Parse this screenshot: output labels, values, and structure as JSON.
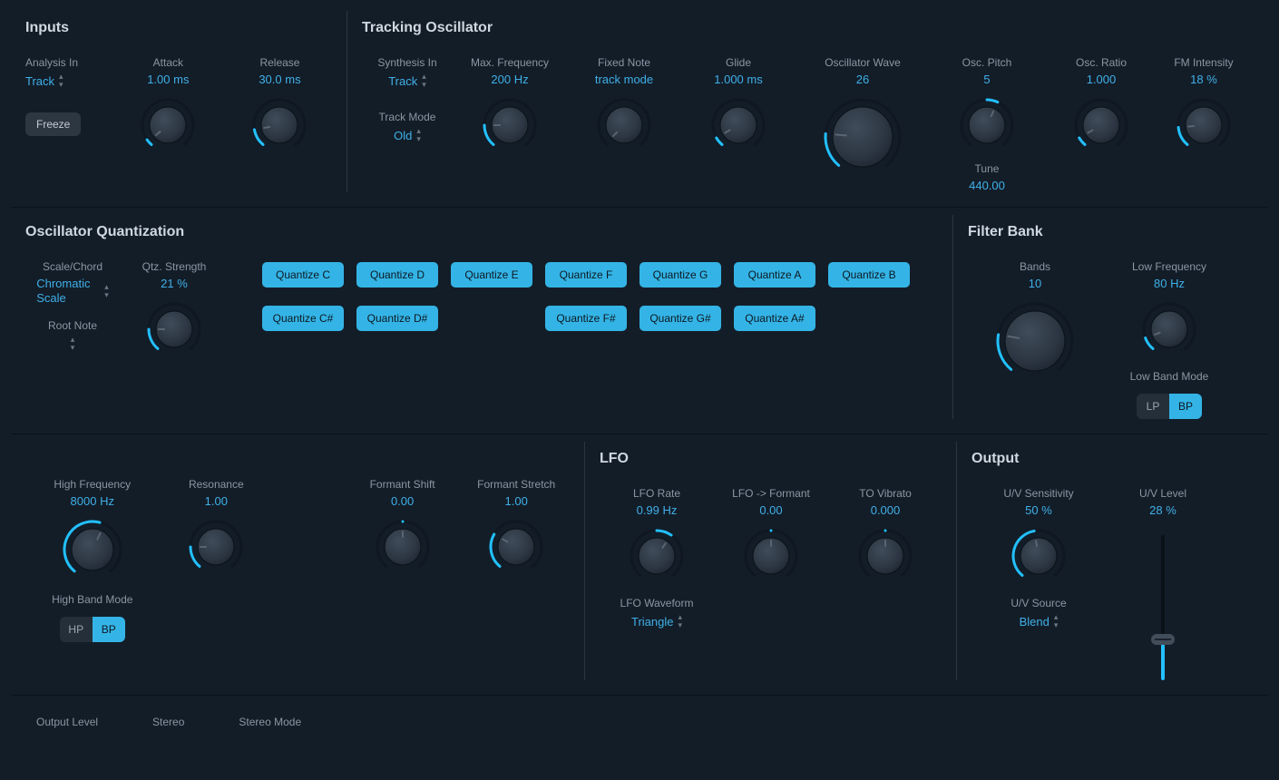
{
  "inputs": {
    "title": "Inputs",
    "analysisIn": {
      "label": "Analysis In",
      "value": "Track"
    },
    "attack": {
      "label": "Attack",
      "value": "1.00 ms"
    },
    "release": {
      "label": "Release",
      "value": "30.0 ms"
    },
    "freeze": "Freeze"
  },
  "tracking": {
    "title": "Tracking Oscillator",
    "synthesisIn": {
      "label": "Synthesis In",
      "value": "Track"
    },
    "trackMode": {
      "label": "Track Mode",
      "value": "Old"
    },
    "maxFreq": {
      "label": "Max. Frequency",
      "value": "200 Hz"
    },
    "fixedNote": {
      "label": "Fixed Note",
      "value": "track mode"
    },
    "glide": {
      "label": "Glide",
      "value": "1.000 ms"
    },
    "oscWave": {
      "label": "Oscillator Wave",
      "value": "26"
    },
    "oscPitch": {
      "label": "Osc. Pitch",
      "value": "5"
    },
    "tune": {
      "label": "Tune",
      "value": "440.00"
    },
    "oscRatio": {
      "label": "Osc. Ratio",
      "value": "1.000"
    },
    "fmIntensity": {
      "label": "FM Intensity",
      "value": "18 %"
    }
  },
  "quant": {
    "title": "Oscillator Quantization",
    "scaleChord": {
      "label": "Scale/Chord",
      "value": "Chromatic Scale"
    },
    "rootNote": {
      "label": "Root Note",
      "value": ""
    },
    "strength": {
      "label": "Qtz. Strength",
      "value": "21 %"
    },
    "buttons": [
      "Quantize C",
      "Quantize D",
      "Quantize E",
      "Quantize F",
      "Quantize G",
      "Quantize A",
      "Quantize B",
      "Quantize C#",
      "Quantize D#",
      "",
      "Quantize F#",
      "Quantize G#",
      "Quantize A#",
      ""
    ]
  },
  "filter": {
    "title": "Filter Bank",
    "bands": {
      "label": "Bands",
      "value": "10"
    },
    "lowFreq": {
      "label": "Low Frequency",
      "value": "80 Hz"
    },
    "lowBandMode": {
      "label": "Low Band Mode",
      "options": [
        "LP",
        "BP"
      ],
      "active": "BP"
    }
  },
  "filter2": {
    "highFreq": {
      "label": "High Frequency",
      "value": "8000 Hz"
    },
    "resonance": {
      "label": "Resonance",
      "value": "1.00"
    },
    "highBandMode": {
      "label": "High Band Mode",
      "options": [
        "HP",
        "BP"
      ],
      "active": "BP"
    },
    "formantShift": {
      "label": "Formant Shift",
      "value": "0.00"
    },
    "formantStretch": {
      "label": "Formant Stretch",
      "value": "1.00"
    }
  },
  "lfo": {
    "title": "LFO",
    "rate": {
      "label": "LFO Rate",
      "value": "0.99 Hz"
    },
    "toFormant": {
      "label": "LFO -> Formant",
      "value": "0.00"
    },
    "vibrato": {
      "label": "TO Vibrato",
      "value": "0.000"
    },
    "waveform": {
      "label": "LFO Waveform",
      "value": "Triangle"
    }
  },
  "output": {
    "title": "Output",
    "uvSens": {
      "label": "U/V Sensitivity",
      "value": "50 %"
    },
    "uvSource": {
      "label": "U/V Source",
      "value": "Blend"
    },
    "uvLevel": {
      "label": "U/V Level",
      "value": "28 %"
    }
  },
  "bottom": {
    "outputLevel": "Output Level",
    "stereo": "Stereo",
    "stereoMode": "Stereo Mode"
  }
}
